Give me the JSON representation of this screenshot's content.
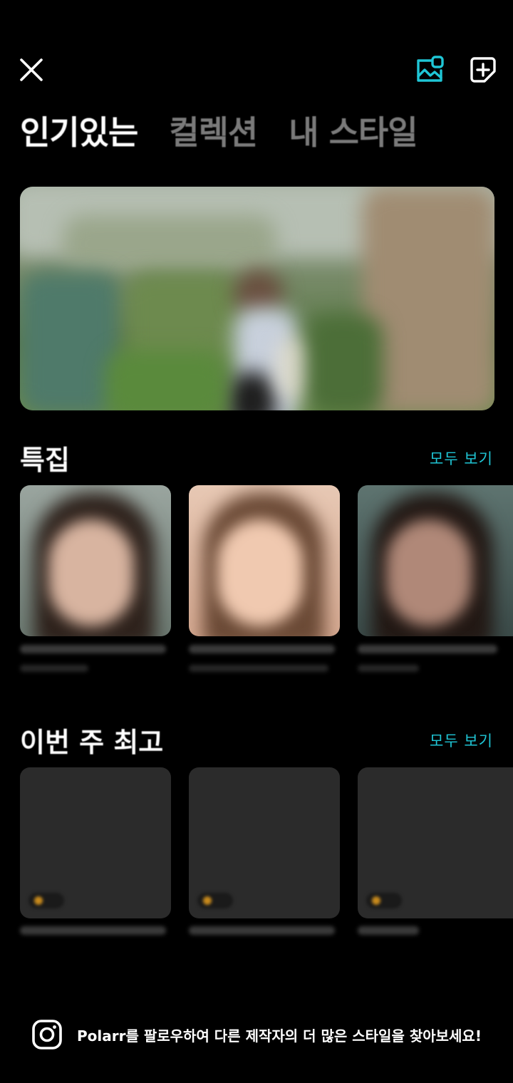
{
  "colors": {
    "accent": "#1fc6d6",
    "background": "#000000",
    "inactive_tab": "#7a7a7a"
  },
  "icons": {
    "close": "close-icon",
    "gallery": "image-gallery-icon",
    "add": "add-square-icon",
    "instagram": "instagram-icon"
  },
  "tabs": [
    {
      "label": "인기있는",
      "active": true
    },
    {
      "label": "컬렉션",
      "active": false
    },
    {
      "label": "내 스타일",
      "active": false
    }
  ],
  "featured": {
    "title": "특집",
    "see_all": "모두 보기"
  },
  "weekly": {
    "title": "이번 주 최고",
    "see_all": "모두 보기"
  },
  "footer": {
    "text": "Polarr를 팔로우하여 다른 제작자의 더 많은 스타일을 찾아보세요!"
  }
}
